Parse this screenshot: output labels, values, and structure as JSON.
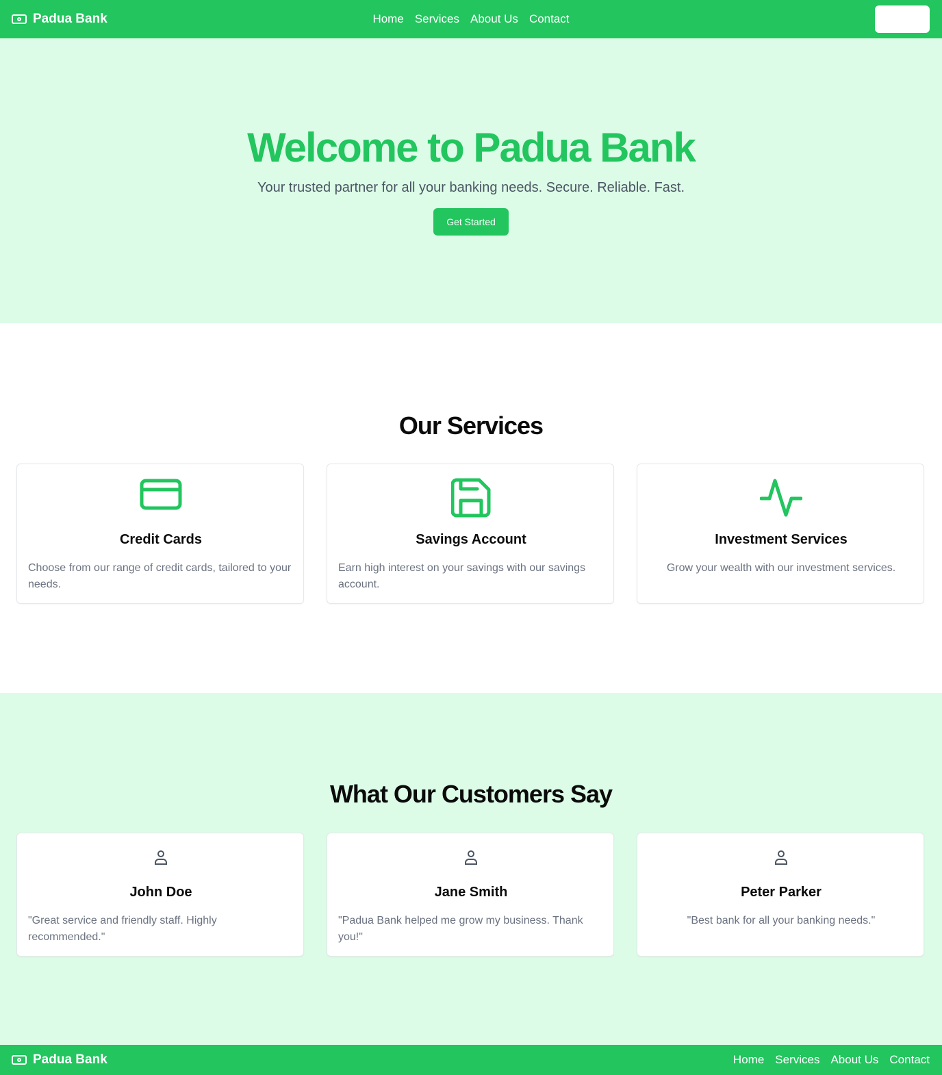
{
  "nav": {
    "brand": "Padua Bank",
    "links": [
      "Home",
      "Services",
      "About Us",
      "Contact"
    ],
    "button_label": ""
  },
  "hero": {
    "title": "Welcome to Padua Bank",
    "subtitle": "Your trusted partner for all your banking needs. Secure. Reliable. Fast.",
    "cta": "Get Started"
  },
  "services": {
    "heading": "Our Services",
    "items": [
      {
        "icon": "credit-card-icon",
        "title": "Credit Cards",
        "text": "Choose from our range of credit cards, tailored to your needs."
      },
      {
        "icon": "save-icon",
        "title": "Savings Account",
        "text": "Earn high interest on your savings with our savings account."
      },
      {
        "icon": "activity-icon",
        "title": "Investment Services",
        "text": "Grow your wealth with our investment services."
      }
    ]
  },
  "testimonials": {
    "heading": "What Our Customers Say",
    "items": [
      {
        "icon": "user-icon",
        "name": "John Doe",
        "quote": "\"Great service and friendly staff. Highly recommended.\""
      },
      {
        "icon": "user-icon",
        "name": "Jane Smith",
        "quote": "\"Padua Bank helped me grow my business. Thank you!\""
      },
      {
        "icon": "user-icon",
        "name": "Peter Parker",
        "quote": "\"Best bank for all your banking needs.\""
      }
    ]
  },
  "footer": {
    "brand": "Padua Bank",
    "links": [
      "Home",
      "Services",
      "About Us",
      "Contact"
    ]
  },
  "colors": {
    "accent": "#22c55e",
    "hero_bg": "#dcfce7",
    "muted_text": "#6b7280"
  }
}
